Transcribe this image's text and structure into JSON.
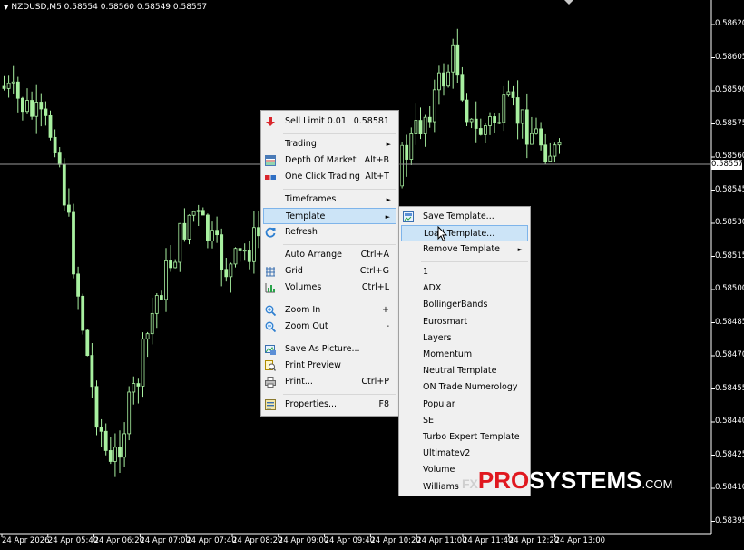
{
  "chart_header": {
    "symbol_text": "NZDUSD,M5  0.58554 0.58560 0.58549 0.58557"
  },
  "y_axis": {
    "labels": [
      "0.58620",
      "0.58605",
      "0.58590",
      "0.58575",
      "0.58560",
      "0.58545",
      "0.58530",
      "0.58515",
      "0.58500",
      "0.58485",
      "0.58470",
      "0.58455",
      "0.58440",
      "0.58425",
      "0.58410",
      "0.58395"
    ]
  },
  "current_price": "0.58557",
  "x_axis": {
    "labels": [
      "24 Apr 2026",
      "24 Apr 05:40",
      "24 Apr 06:20",
      "24 Apr 07:00",
      "24 Apr 07:40",
      "24 Apr 08:20",
      "24 Apr 09:00",
      "24 Apr 09:40",
      "24 Apr 10:20",
      "24 Apr 11:00",
      "24 Apr 11:40",
      "24 Apr 12:20",
      "24 Apr 13:00"
    ]
  },
  "colors": {
    "background": "#000000",
    "candle": "#a8f0a0",
    "text": "#ffffff",
    "menu_bg": "#f0f0f0",
    "highlight": "#cce4f7",
    "logo_red": "#e0181f"
  },
  "context_menu": {
    "sell_limit": {
      "label": "Sell Limit 0.01",
      "price": "0.58581",
      "icon": "sell-arrow-icon"
    },
    "trading": {
      "label": "Trading"
    },
    "depth_of_market": {
      "label": "Depth Of Market",
      "shortcut": "Alt+B",
      "icon": "depth-of-market-icon"
    },
    "one_click_trading": {
      "label": "One Click Trading",
      "shortcut": "Alt+T",
      "icon": "one-click-trading-icon"
    },
    "timeframes": {
      "label": "Timeframes"
    },
    "template": {
      "label": "Template"
    },
    "refresh": {
      "label": "Refresh",
      "icon": "refresh-icon"
    },
    "auto_arrange": {
      "label": "Auto Arrange",
      "shortcut": "Ctrl+A"
    },
    "grid": {
      "label": "Grid",
      "shortcut": "Ctrl+G",
      "icon": "grid-icon"
    },
    "volumes": {
      "label": "Volumes",
      "shortcut": "Ctrl+L",
      "icon": "volumes-icon"
    },
    "zoom_in": {
      "label": "Zoom In",
      "shortcut": "+",
      "icon": "zoom-in-icon"
    },
    "zoom_out": {
      "label": "Zoom Out",
      "shortcut": "-",
      "icon": "zoom-out-icon"
    },
    "save_as_picture": {
      "label": "Save As Picture...",
      "icon": "save-picture-icon"
    },
    "print_preview": {
      "label": "Print Preview",
      "icon": "print-preview-icon"
    },
    "print": {
      "label": "Print...",
      "shortcut": "Ctrl+P",
      "icon": "printer-icon"
    },
    "properties": {
      "label": "Properties...",
      "shortcut": "F8",
      "icon": "properties-icon"
    }
  },
  "template_submenu": {
    "save_template": {
      "label": "Save Template...",
      "icon": "save-template-icon"
    },
    "load_template": {
      "label": "Load Template..."
    },
    "remove_template": {
      "label": "Remove Template"
    },
    "templates": [
      "1",
      "ADX",
      "BollingerBands",
      "Eurosmart",
      "Layers",
      "Momentum",
      "Neutral Template",
      "ON Trade Numerology",
      "Popular",
      "SE",
      "Turbo Expert Template",
      "Ultimatev2",
      "Volume",
      "Williams"
    ]
  },
  "watermark": {
    "fx": "FX",
    "pro": "PRO",
    "systems": "SYSTEMS",
    ".com": ".COM"
  }
}
